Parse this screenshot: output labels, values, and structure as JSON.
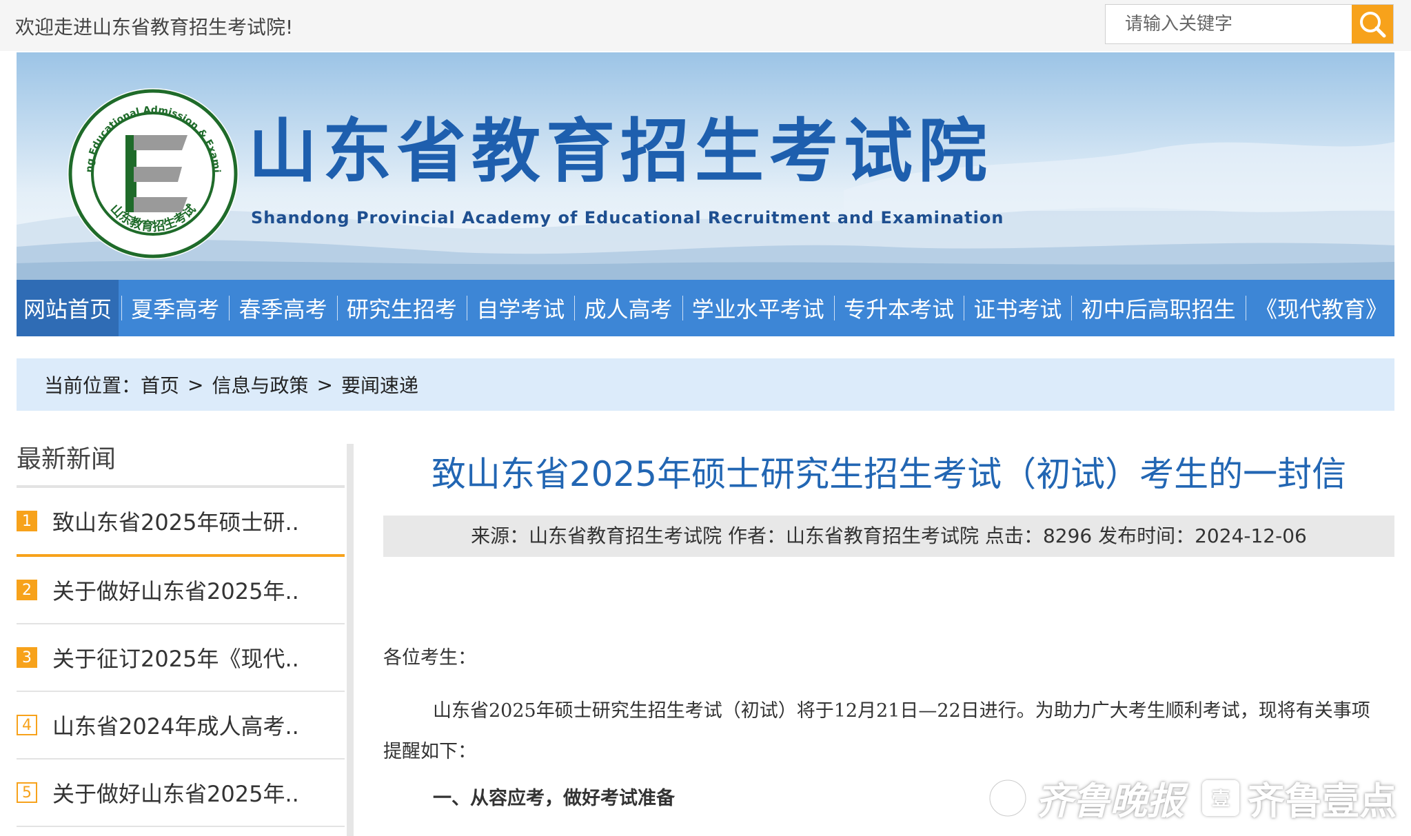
{
  "header": {
    "welcome": "欢迎走进山东省教育招生考试院!",
    "search_placeholder": "请输入关键字"
  },
  "banner": {
    "title_cn": "山东省教育招生考试院",
    "title_en": "Shandong Provincial Academy of Educational Recruitment and Examination",
    "logo_ring_en": "Shandong Educational Admission & Examinations",
    "logo_ring_cn": "山东教育招生考试"
  },
  "nav": {
    "items": [
      "网站首页",
      "夏季高考",
      "春季高考",
      "研究生招考",
      "自学考试",
      "成人高考",
      "学业水平考试",
      "专升本考试",
      "证书考试",
      "初中后高职招生",
      "《现代教育》"
    ]
  },
  "breadcrumb": {
    "label": "当前位置：",
    "items": [
      "首页",
      "信息与政策",
      "要闻速递"
    ],
    "sep": ">"
  },
  "sidebar": {
    "title": "最新新闻",
    "items": [
      {
        "num": "1",
        "text": "致山东省2025年硕士研.."
      },
      {
        "num": "2",
        "text": "关于做好山东省2025年.."
      },
      {
        "num": "3",
        "text": "关于征订2025年《现代.."
      },
      {
        "num": "4",
        "text": "山东省2024年成人高考.."
      },
      {
        "num": "5",
        "text": "关于做好山东省2025年.."
      }
    ]
  },
  "article": {
    "title": "致山东省2025年硕士研究生招生考试（初试）考生的一封信",
    "meta": "来源：山东省教育招生考试院 作者：山东省教育招生考试院 点击：8296 发布时间：2024-12-06",
    "greeting": "各位考生：",
    "para1_line1": "山东省2025年硕士研究生招生考试（初试）将于12月21日—22日进行。为助力广大考生顺利考试，现将有关事项",
    "para1_line2": "提醒如下：",
    "section1": "一、从容应考，做好考试准备"
  },
  "watermark": {
    "text1": "齐鲁晚报",
    "badge": "壹",
    "text2": "齐鲁壹点"
  },
  "colors": {
    "nav_bg": "#3d86d6",
    "nav_active": "#2f6cb5",
    "accent_orange": "#f7a21b",
    "title_blue": "#2266b3"
  }
}
